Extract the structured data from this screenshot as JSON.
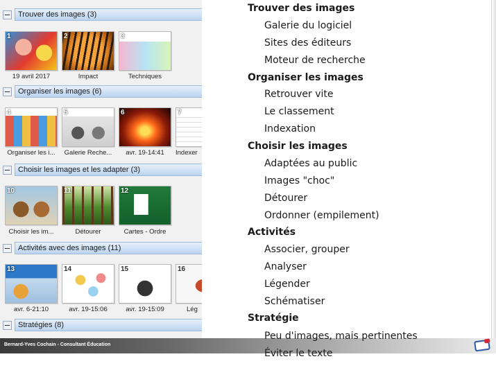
{
  "sorter": {
    "groups": [
      {
        "label": "Trouver des images (3)"
      },
      {
        "label": "Organiser les images (6)"
      },
      {
        "label": "Choisir les images et les adapter (3)"
      },
      {
        "label": "Activités avec des images (11)"
      },
      {
        "label": "Stratégies (8)"
      }
    ],
    "slides": [
      {
        "num": "1",
        "caption": "19 avril 2017"
      },
      {
        "num": "2",
        "caption": "Impact"
      },
      {
        "num": "3",
        "caption": "Techniques"
      },
      {
        "num": "4",
        "caption": "Organiser les i..."
      },
      {
        "num": "5",
        "caption": "Galerie Reche..."
      },
      {
        "num": "6",
        "caption": "avr. 19-14:41"
      },
      {
        "num": "7",
        "caption": "Indexer"
      },
      {
        "num": "10",
        "caption": "Choisir les im..."
      },
      {
        "num": "11",
        "caption": "Détourer"
      },
      {
        "num": "12",
        "caption": "Cartes - Ordre"
      },
      {
        "num": "13",
        "caption": "avr. 6-21:10"
      },
      {
        "num": "14",
        "caption": "avr. 19-15:06"
      },
      {
        "num": "15",
        "caption": "avr. 19-15:09"
      },
      {
        "num": "16",
        "caption": "Lég"
      }
    ]
  },
  "outline": {
    "sections": [
      {
        "title": "Trouver des images",
        "items": [
          "Galerie du logiciel",
          "Sites des éditeurs",
          "Moteur de recherche"
        ]
      },
      {
        "title": "Organiser les images",
        "items": [
          "Retrouver vite",
          "Le classement",
          "Indexation"
        ]
      },
      {
        "title": "Choisir les images",
        "items": [
          "Adaptées au public",
          "Images \"choc\"",
          "Détourer",
          "Ordonner (empilement)"
        ]
      },
      {
        "title": "Activités",
        "items": [
          "Associer, grouper",
          "Analyser",
          "Légender",
          "Schématiser"
        ]
      },
      {
        "title": "Stratégie",
        "items": [
          "Peu d'images, mais pertinentes",
          "Éviter le texte"
        ]
      }
    ]
  },
  "footer": {
    "text": "Bernard-Yves Cochain - Consultant Éducation"
  }
}
